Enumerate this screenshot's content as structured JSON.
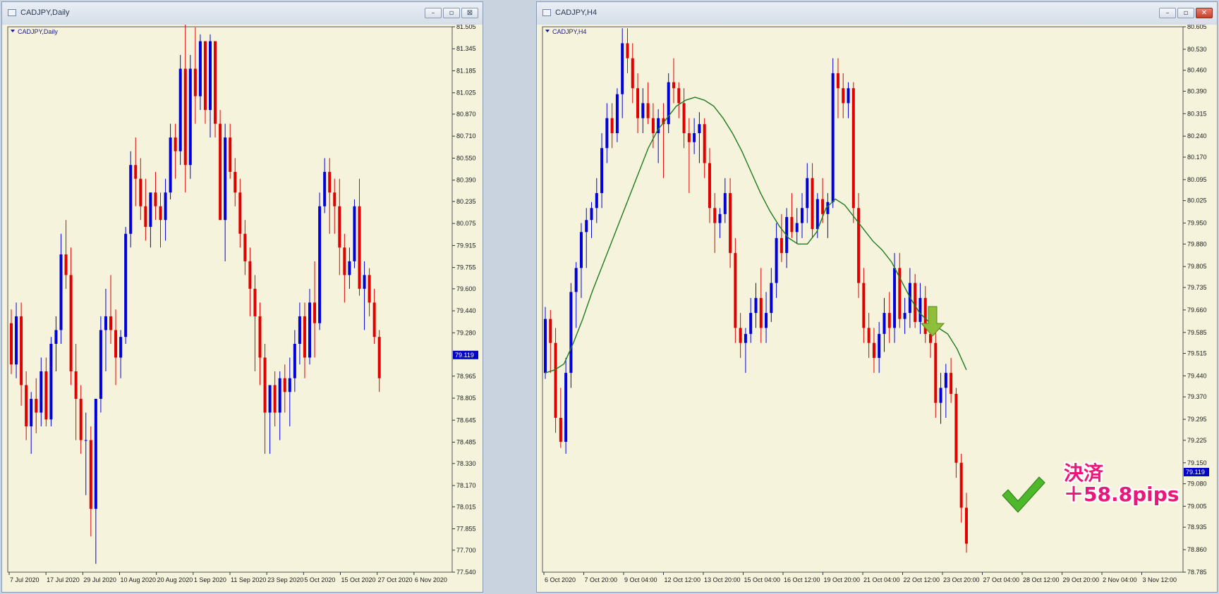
{
  "windows": [
    {
      "title": "CADJPY,Daily",
      "symbol_label": "CADJPY,Daily",
      "buttons": [
        "–",
        "▫",
        "⊠"
      ],
      "chart_data": {
        "type": "candlestick",
        "symbol": "CADJPY",
        "timeframe": "Daily",
        "y_ticks": [
          "81.505",
          "81.345",
          "81.185",
          "81.025",
          "80.870",
          "80.710",
          "80.550",
          "80.390",
          "80.235",
          "80.075",
          "79.915",
          "79.755",
          "79.600",
          "79.440",
          "79.280",
          "79.119",
          "78.965",
          "78.805",
          "78.645",
          "78.485",
          "78.330",
          "78.170",
          "78.015",
          "77.855",
          "77.700",
          "77.540"
        ],
        "ylim": [
          77.54,
          81.505
        ],
        "current_price": "79.119",
        "x_ticks": [
          "7 Jul 2020",
          "17 Jul 2020",
          "29 Jul 2020",
          "10 Aug 2020",
          "20 Aug 2020",
          "1 Sep 2020",
          "11 Sep 2020",
          "23 Sep 2020",
          "5 Oct 2020",
          "15 Oct 2020",
          "27 Oct 2020",
          "6 Nov 2020"
        ],
        "candles": [
          [
            79.35,
            79.45,
            78.98,
            79.05
          ],
          [
            79.05,
            79.5,
            78.95,
            79.4
          ],
          [
            79.4,
            79.5,
            78.75,
            78.9
          ],
          [
            78.9,
            79.0,
            78.5,
            78.6
          ],
          [
            78.6,
            78.85,
            78.4,
            78.8
          ],
          [
            78.8,
            78.95,
            78.55,
            78.7
          ],
          [
            78.7,
            79.1,
            78.6,
            79.0
          ],
          [
            79.0,
            79.1,
            78.6,
            78.65
          ],
          [
            78.65,
            79.25,
            78.6,
            79.2
          ],
          [
            79.2,
            79.4,
            79.0,
            79.3
          ],
          [
            79.3,
            80.0,
            79.2,
            79.85
          ],
          [
            79.85,
            80.1,
            79.6,
            79.7
          ],
          [
            79.7,
            79.9,
            78.9,
            79.0
          ],
          [
            79.0,
            79.2,
            78.5,
            78.8
          ],
          [
            78.8,
            78.9,
            78.4,
            78.5
          ],
          [
            78.5,
            78.7,
            78.1,
            78.5
          ],
          [
            78.5,
            78.6,
            77.8,
            78.0
          ],
          [
            78.0,
            78.8,
            77.6,
            78.8
          ],
          [
            78.8,
            79.4,
            78.7,
            79.3
          ],
          [
            79.3,
            79.6,
            79.0,
            79.4
          ],
          [
            79.4,
            79.7,
            79.2,
            79.3
          ],
          [
            79.3,
            79.45,
            78.9,
            79.1
          ],
          [
            79.1,
            79.3,
            78.95,
            79.25
          ],
          [
            79.25,
            80.05,
            79.2,
            80.0
          ],
          [
            80.0,
            80.6,
            79.9,
            80.5
          ],
          [
            80.5,
            80.7,
            80.2,
            80.4
          ],
          [
            80.4,
            80.55,
            80.1,
            80.2
          ],
          [
            80.2,
            80.4,
            79.95,
            80.05
          ],
          [
            80.05,
            80.3,
            79.9,
            80.3
          ],
          [
            80.3,
            80.45,
            80.1,
            80.2
          ],
          [
            80.2,
            80.3,
            79.9,
            80.1
          ],
          [
            80.1,
            80.4,
            79.95,
            80.3
          ],
          [
            80.3,
            80.8,
            80.25,
            80.7
          ],
          [
            80.7,
            80.8,
            80.4,
            80.6
          ],
          [
            80.6,
            81.3,
            80.5,
            81.2
          ],
          [
            81.2,
            81.6,
            80.3,
            80.5
          ],
          [
            80.5,
            81.3,
            80.4,
            81.2
          ],
          [
            81.2,
            81.5,
            80.8,
            81.0
          ],
          [
            81.0,
            81.45,
            80.9,
            81.4
          ],
          [
            81.4,
            81.4,
            80.8,
            80.9
          ],
          [
            80.9,
            81.45,
            80.7,
            81.4
          ],
          [
            81.4,
            81.4,
            80.7,
            80.8
          ],
          [
            80.8,
            80.9,
            80.1,
            80.1
          ],
          [
            80.1,
            80.8,
            79.8,
            80.7
          ],
          [
            80.7,
            80.8,
            80.4,
            80.45
          ],
          [
            80.45,
            80.55,
            80.2,
            80.3
          ],
          [
            80.3,
            80.4,
            79.9,
            80.0
          ],
          [
            80.0,
            80.1,
            79.7,
            79.8
          ],
          [
            79.8,
            79.9,
            79.4,
            79.6
          ],
          [
            79.6,
            79.7,
            79.0,
            79.4
          ],
          [
            79.4,
            79.5,
            78.9,
            79.1
          ],
          [
            79.1,
            79.2,
            78.4,
            78.7
          ],
          [
            78.7,
            78.8,
            78.4,
            78.9
          ],
          [
            78.9,
            79.0,
            78.6,
            78.7
          ],
          [
            78.7,
            79.0,
            78.5,
            78.95
          ],
          [
            78.95,
            79.05,
            78.7,
            78.85
          ],
          [
            78.85,
            79.1,
            78.6,
            78.95
          ],
          [
            78.95,
            79.3,
            78.85,
            79.2
          ],
          [
            79.2,
            79.5,
            79.05,
            79.4
          ],
          [
            79.4,
            79.5,
            78.95,
            79.1
          ],
          [
            79.1,
            79.6,
            79.05,
            79.5
          ],
          [
            79.5,
            79.8,
            79.1,
            79.35
          ],
          [
            79.35,
            80.3,
            79.3,
            80.2
          ],
          [
            80.2,
            80.55,
            80.15,
            80.45
          ],
          [
            80.45,
            80.55,
            80.0,
            80.3
          ],
          [
            80.3,
            80.4,
            80.0,
            80.2
          ],
          [
            80.2,
            80.4,
            79.7,
            79.9
          ],
          [
            79.9,
            80.0,
            79.5,
            79.7
          ],
          [
            79.7,
            79.9,
            79.6,
            79.8
          ],
          [
            79.8,
            80.25,
            79.75,
            80.2
          ],
          [
            80.2,
            80.4,
            79.55,
            79.6
          ],
          [
            79.6,
            79.8,
            79.3,
            79.7
          ],
          [
            79.7,
            79.75,
            79.4,
            79.5
          ],
          [
            79.5,
            79.6,
            79.2,
            79.25
          ],
          [
            79.25,
            79.3,
            78.85,
            78.95
          ]
        ]
      }
    },
    {
      "title": "CADJPY,H4",
      "symbol_label": "CADJPY,H4",
      "buttons": [
        "–",
        "▫",
        "✕"
      ],
      "annotation_line1": "決済",
      "annotation_line2": "＋58.8pips",
      "chart_data": {
        "type": "candlestick",
        "symbol": "CADJPY",
        "timeframe": "H4",
        "y_ticks": [
          "80.605",
          "80.530",
          "80.460",
          "80.390",
          "80.315",
          "80.240",
          "80.170",
          "80.095",
          "80.025",
          "79.950",
          "79.880",
          "79.805",
          "79.735",
          "79.660",
          "79.585",
          "79.515",
          "79.440",
          "79.370",
          "79.295",
          "79.225",
          "79.150",
          "79.119",
          "79.080",
          "79.005",
          "78.935",
          "78.860",
          "78.785"
        ],
        "ylim": [
          78.785,
          80.605
        ],
        "current_price": "79.119",
        "x_ticks": [
          "6 Oct 2020",
          "7 Oct 20:00",
          "9 Oct 04:00",
          "12 Oct 12:00",
          "13 Oct 20:00",
          "15 Oct 04:00",
          "16 Oct 12:00",
          "19 Oct 20:00",
          "21 Oct 04:00",
          "22 Oct 12:00",
          "23 Oct 20:00",
          "27 Oct 04:00",
          "28 Oct 12:00",
          "29 Oct 20:00",
          "2 Nov 04:00",
          "3 Nov 12:00"
        ],
        "candles": [
          [
            79.45,
            79.67,
            79.43,
            79.63
          ],
          [
            79.63,
            79.66,
            79.45,
            79.55
          ],
          [
            79.55,
            79.6,
            79.25,
            79.3
          ],
          [
            79.3,
            79.4,
            79.2,
            79.22
          ],
          [
            79.22,
            79.5,
            79.18,
            79.45
          ],
          [
            79.45,
            79.75,
            79.4,
            79.72
          ],
          [
            79.72,
            79.82,
            79.6,
            79.8
          ],
          [
            79.8,
            79.95,
            79.7,
            79.92
          ],
          [
            79.92,
            80.0,
            79.8,
            79.96
          ],
          [
            79.96,
            80.02,
            79.9,
            80.0
          ],
          [
            80.0,
            80.1,
            79.95,
            80.05
          ],
          [
            80.05,
            80.25,
            80.0,
            80.2
          ],
          [
            80.2,
            80.35,
            80.15,
            80.3
          ],
          [
            80.3,
            80.35,
            80.2,
            80.25
          ],
          [
            80.25,
            80.4,
            80.22,
            80.38
          ],
          [
            80.38,
            80.6,
            80.3,
            80.55
          ],
          [
            80.55,
            80.6,
            80.45,
            80.5
          ],
          [
            80.5,
            80.55,
            80.35,
            80.4
          ],
          [
            80.4,
            80.45,
            80.25,
            80.3
          ],
          [
            80.3,
            80.4,
            80.25,
            80.35
          ],
          [
            80.35,
            80.42,
            80.28,
            80.3
          ],
          [
            80.3,
            80.35,
            80.2,
            80.25
          ],
          [
            80.25,
            80.33,
            80.15,
            80.3
          ],
          [
            80.3,
            80.35,
            80.1,
            80.28
          ],
          [
            80.28,
            80.45,
            80.25,
            80.42
          ],
          [
            80.42,
            80.5,
            80.35,
            80.4
          ],
          [
            80.4,
            80.42,
            80.3,
            80.35
          ],
          [
            80.35,
            80.4,
            80.2,
            80.25
          ],
          [
            80.25,
            80.3,
            80.05,
            80.22
          ],
          [
            80.22,
            80.3,
            80.18,
            80.25
          ],
          [
            80.25,
            80.32,
            80.15,
            80.28
          ],
          [
            80.28,
            80.3,
            80.1,
            80.15
          ],
          [
            80.15,
            80.2,
            79.95,
            80.0
          ],
          [
            80.0,
            80.05,
            79.85,
            79.95
          ],
          [
            79.95,
            80.0,
            79.9,
            79.98
          ],
          [
            79.98,
            80.1,
            79.95,
            80.05
          ],
          [
            80.05,
            80.1,
            79.8,
            79.85
          ],
          [
            79.85,
            79.9,
            79.55,
            79.6
          ],
          [
            79.6,
            79.65,
            79.5,
            79.55
          ],
          [
            79.55,
            79.6,
            79.45,
            79.58
          ],
          [
            79.58,
            79.7,
            79.55,
            79.65
          ],
          [
            79.65,
            79.75,
            79.6,
            79.7
          ],
          [
            79.7,
            79.8,
            79.55,
            79.6
          ],
          [
            79.6,
            79.72,
            79.55,
            79.65
          ],
          [
            79.65,
            79.8,
            79.62,
            79.75
          ],
          [
            79.75,
            79.95,
            79.7,
            79.9
          ],
          [
            79.9,
            79.98,
            79.82,
            79.85
          ],
          [
            79.85,
            80.0,
            79.8,
            79.97
          ],
          [
            79.97,
            80.05,
            79.9,
            79.92
          ],
          [
            79.92,
            80.0,
            79.88,
            79.95
          ],
          [
            79.95,
            80.05,
            79.9,
            80.0
          ],
          [
            80.0,
            80.15,
            79.95,
            80.1
          ],
          [
            80.1,
            80.15,
            79.9,
            79.93
          ],
          [
            79.93,
            80.05,
            79.9,
            80.03
          ],
          [
            80.03,
            80.1,
            79.95,
            79.98
          ],
          [
            79.98,
            80.05,
            79.9,
            80.02
          ],
          [
            80.02,
            80.5,
            80.0,
            80.45
          ],
          [
            80.45,
            80.5,
            80.3,
            80.4
          ],
          [
            80.4,
            80.45,
            80.3,
            80.35
          ],
          [
            80.35,
            80.42,
            80.3,
            80.4
          ],
          [
            80.4,
            80.42,
            79.95,
            80.0
          ],
          [
            80.0,
            80.05,
            79.7,
            79.75
          ],
          [
            79.75,
            79.8,
            79.55,
            79.6
          ],
          [
            79.6,
            79.65,
            79.5,
            79.55
          ],
          [
            79.55,
            79.6,
            79.45,
            79.5
          ],
          [
            79.5,
            79.62,
            79.45,
            79.58
          ],
          [
            79.58,
            79.7,
            79.52,
            79.65
          ],
          [
            79.65,
            79.72,
            79.55,
            79.6
          ],
          [
            79.6,
            79.85,
            79.55,
            79.8
          ],
          [
            79.8,
            79.85,
            79.6,
            79.63
          ],
          [
            79.63,
            79.7,
            79.58,
            79.65
          ],
          [
            79.65,
            79.8,
            79.6,
            79.75
          ],
          [
            79.75,
            79.78,
            79.6,
            79.62
          ],
          [
            79.62,
            79.75,
            79.58,
            79.7
          ],
          [
            79.7,
            79.74,
            79.55,
            79.58
          ],
          [
            79.58,
            79.62,
            79.5,
            79.55
          ],
          [
            79.55,
            79.6,
            79.3,
            79.35
          ],
          [
            79.35,
            79.45,
            79.28,
            79.4
          ],
          [
            79.4,
            79.48,
            79.3,
            79.45
          ],
          [
            79.45,
            79.5,
            79.35,
            79.38
          ],
          [
            79.38,
            79.4,
            79.1,
            79.15
          ],
          [
            79.15,
            79.18,
            78.95,
            79.0
          ],
          [
            79.0,
            79.05,
            78.85,
            78.88
          ]
        ],
        "moving_average": [
          79.45,
          79.46,
          79.48,
          79.55,
          79.63,
          79.72,
          79.8,
          79.88,
          79.96,
          80.04,
          80.12,
          80.2,
          80.26,
          80.3,
          80.34,
          80.36,
          80.37,
          80.36,
          80.34,
          80.3,
          80.25,
          80.19,
          80.12,
          80.05,
          79.99,
          79.94,
          79.9,
          79.88,
          79.88,
          79.92,
          80.0,
          80.03,
          80.01,
          79.97,
          79.93,
          79.89,
          79.86,
          79.82,
          79.76,
          79.7,
          79.65,
          79.62,
          79.6,
          79.58,
          79.53,
          79.46
        ]
      }
    }
  ]
}
